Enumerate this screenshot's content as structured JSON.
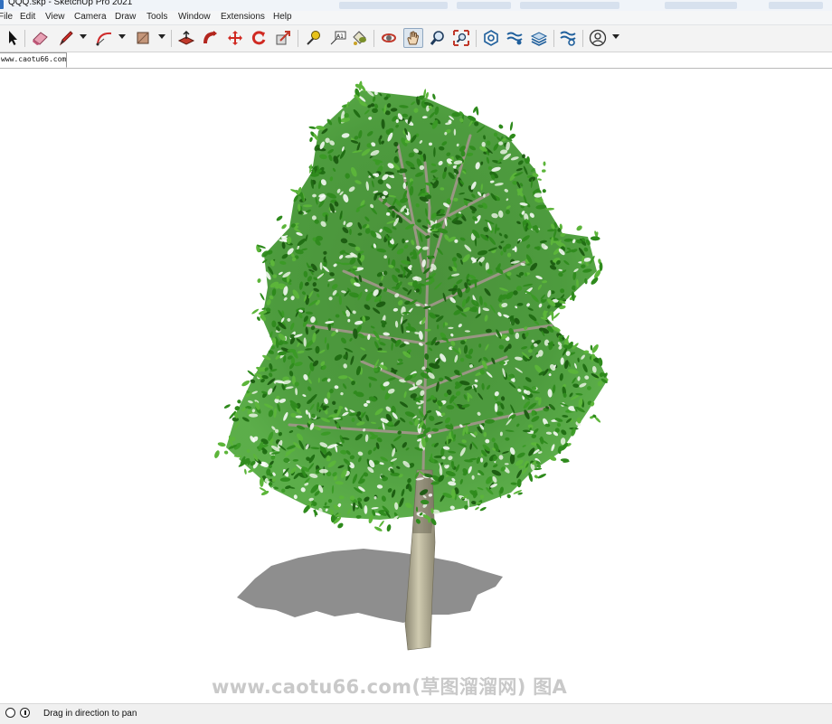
{
  "window": {
    "title": "QQQ.skp - SketchUp Pro 2021"
  },
  "menu": [
    "File",
    "Edit",
    "View",
    "Camera",
    "Draw",
    "Tools",
    "Window",
    "Extensions",
    "Help"
  ],
  "toolbar": {
    "tools": [
      {
        "name": "select-tool-button",
        "icon": "arrow-cursor-icon"
      },
      {
        "name": "eraser-tool-button",
        "icon": "eraser-icon"
      },
      {
        "name": "line-tool-button",
        "icon": "pencil-icon"
      },
      {
        "name": "arc-tool-button",
        "icon": "arc-icon"
      },
      {
        "name": "rectangle-tool-button",
        "icon": "rectangle-icon"
      },
      {
        "name": "push-pull-tool-button",
        "icon": "push-pull-icon"
      },
      {
        "name": "follow-me-tool-button",
        "icon": "follow-me-icon"
      },
      {
        "name": "move-tool-button",
        "icon": "move-icon"
      },
      {
        "name": "rotate-tool-button",
        "icon": "rotate-icon"
      },
      {
        "name": "scale-tool-button",
        "icon": "scale-icon"
      },
      {
        "name": "tape-measure-tool-button",
        "icon": "tape-measure-icon"
      },
      {
        "name": "text-tool-button",
        "icon": "text-icon",
        "label": "A1"
      },
      {
        "name": "paint-bucket-tool-button",
        "icon": "paint-bucket-icon"
      },
      {
        "name": "orbit-tool-button",
        "icon": "orbit-icon"
      },
      {
        "name": "pan-tool-button",
        "icon": "pan-hand-icon",
        "active": true
      },
      {
        "name": "zoom-tool-button",
        "icon": "zoom-icon"
      },
      {
        "name": "zoom-extents-tool-button",
        "icon": "zoom-extents-icon"
      },
      {
        "name": "warehouse-button",
        "icon": "3d-warehouse-icon"
      },
      {
        "name": "extension-warehouse-button",
        "icon": "extension-warehouse-icon"
      },
      {
        "name": "sketchup-layout-button",
        "icon": "layout-icon"
      },
      {
        "name": "extension-manager-button",
        "icon": "extension-manager-icon"
      },
      {
        "name": "account-button",
        "icon": "user-account-icon"
      }
    ]
  },
  "scene_tabs": [
    "www.caotu66.com"
  ],
  "viewport": {
    "model": "tree",
    "watermark": "www.caotu66.com(草图溜溜网) 图A",
    "colors": {
      "foliage_dark": "#1f6b12",
      "foliage": "#2e8a1c",
      "foliage_light": "#5cb53a",
      "trunk": "#b9b49a",
      "shadow": "#8e8e8e"
    }
  },
  "status": {
    "text": "Drag in direction to pan",
    "icons": [
      "geo-location-icon",
      "info-icon"
    ]
  }
}
